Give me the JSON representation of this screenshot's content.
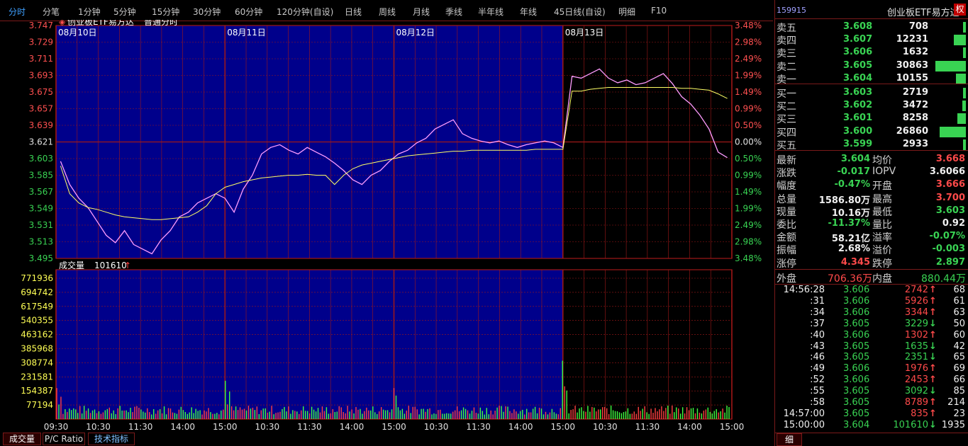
{
  "periods": [
    "分时",
    "分笔",
    "1分钟",
    "5分钟",
    "15分钟",
    "30分钟",
    "60分钟",
    "120分钟(自设)",
    "日线",
    "周线",
    "月线",
    "季线",
    "半年线",
    "年线",
    "45日线(自设)",
    "明细",
    "F10"
  ],
  "active_period": "分时",
  "chart": {
    "title": "创业板ETF易方达",
    "mode": "普通分时",
    "day_labels": [
      "08月10日",
      "08月11日",
      "08月12日",
      "08月13日"
    ],
    "price_ticks": [
      "3.747",
      "3.729",
      "3.711",
      "3.693",
      "3.675",
      "3.657",
      "3.639",
      "3.621",
      "3.603",
      "3.585",
      "3.567",
      "3.549",
      "3.531",
      "3.513",
      "3.495"
    ],
    "pct_ticks": [
      "3.48%",
      "2.98%",
      "2.49%",
      "1.99%",
      "1.49%",
      "0.99%",
      "0.50%",
      "0.00%",
      "0.50%",
      "0.99%",
      "1.49%",
      "1.99%",
      "2.49%",
      "2.98%",
      "3.48%"
    ],
    "volume_label": "成交量",
    "volume_value": "101610",
    "volume_ticks": [
      "771936",
      "694742",
      "617549",
      "540355",
      "463162",
      "385968",
      "308774",
      "231581",
      "154387",
      "77194"
    ],
    "time_ticks": [
      "09:30",
      "10:30",
      "11:30",
      "14:00",
      "15:00",
      "10:30",
      "11:30",
      "14:00",
      "15:00",
      "10:30",
      "11:30",
      "14:00",
      "15:00",
      "10:30",
      "11:30",
      "14:00",
      "15:00"
    ],
    "colors": {
      "bg_active": "#00008b",
      "grid": "#a01818",
      "price_line": "#ff9cff",
      "avg_line": "#ffff66",
      "up": "#ff4040",
      "down": "#40ff40"
    }
  },
  "chart_data": {
    "type": "line",
    "title": "创业板ETF易方达",
    "ylim": [
      3.495,
      3.747
    ],
    "prev_close": 3.621,
    "days": [
      "08月10日",
      "08月11日",
      "08月12日",
      "08月13日"
    ],
    "series": [
      {
        "name": "price",
        "values": [
          3.6,
          3.575,
          3.56,
          3.55,
          3.535,
          3.52,
          3.512,
          3.525,
          3.51,
          3.505,
          3.5,
          3.515,
          3.525,
          3.54,
          3.545,
          3.555,
          3.56,
          3.565,
          3.56,
          3.545,
          3.57,
          3.585,
          3.608,
          3.615,
          3.618,
          3.612,
          3.608,
          3.615,
          3.61,
          3.605,
          3.598,
          3.59,
          3.58,
          3.575,
          3.585,
          3.59,
          3.6,
          3.608,
          3.612,
          3.62,
          3.625,
          3.635,
          3.64,
          3.645,
          3.63,
          3.625,
          3.622,
          3.62,
          3.622,
          3.618,
          3.615,
          3.618,
          3.62,
          3.622,
          3.62,
          3.615,
          3.692,
          3.69,
          3.695,
          3.7,
          3.69,
          3.685,
          3.688,
          3.683,
          3.685,
          3.69,
          3.695,
          3.684,
          3.67,
          3.662,
          3.65,
          3.635,
          3.61,
          3.604
        ]
      },
      {
        "name": "avg",
        "values": [
          3.595,
          3.565,
          3.555,
          3.55,
          3.548,
          3.545,
          3.542,
          3.54,
          3.539,
          3.538,
          3.537,
          3.537,
          3.538,
          3.539,
          3.54,
          3.545,
          3.552,
          3.565,
          3.572,
          3.575,
          3.578,
          3.58,
          3.582,
          3.583,
          3.584,
          3.585,
          3.585,
          3.586,
          3.585,
          3.585,
          3.575,
          3.585,
          3.592,
          3.596,
          3.598,
          3.6,
          3.602,
          3.604,
          3.606,
          3.607,
          3.608,
          3.609,
          3.61,
          3.611,
          3.611,
          3.612,
          3.612,
          3.612,
          3.612,
          3.612,
          3.612,
          3.612,
          3.613,
          3.613,
          3.613,
          3.613,
          3.676,
          3.676,
          3.678,
          3.679,
          3.68,
          3.68,
          3.68,
          3.68,
          3.68,
          3.68,
          3.68,
          3.68,
          3.679,
          3.679,
          3.678,
          3.677,
          3.673,
          3.668
        ]
      }
    ],
    "volume_ylim": [
      0,
      771936
    ]
  },
  "quote": {
    "code": "159915",
    "name": "创业板ETF易方达",
    "badge": "权",
    "sell": [
      {
        "label": "卖五",
        "price": "3.608",
        "vol": "708",
        "bar": 0.05
      },
      {
        "label": "卖四",
        "price": "3.607",
        "vol": "12231",
        "bar": 0.35
      },
      {
        "label": "卖三",
        "price": "3.606",
        "vol": "1632",
        "bar": 0.05
      },
      {
        "label": "卖二",
        "price": "3.605",
        "vol": "30863",
        "bar": 0.9
      },
      {
        "label": "卖一",
        "price": "3.604",
        "vol": "10155",
        "bar": 0.3
      }
    ],
    "buy": [
      {
        "label": "买一",
        "price": "3.603",
        "vol": "2719",
        "bar": 0.08
      },
      {
        "label": "买二",
        "price": "3.602",
        "vol": "3472",
        "bar": 0.1
      },
      {
        "label": "买三",
        "price": "3.601",
        "vol": "8258",
        "bar": 0.24
      },
      {
        "label": "买四",
        "price": "3.600",
        "vol": "26860",
        "bar": 0.78
      },
      {
        "label": "买五",
        "price": "3.599",
        "vol": "2933",
        "bar": 0.09
      }
    ],
    "stats": [
      {
        "l1": "最新",
        "v1": "3.604",
        "c1": "green",
        "l2": "均价",
        "v2": "3.668",
        "c2": "red"
      },
      {
        "l1": "涨跌",
        "v1": "-0.017",
        "c1": "green",
        "l2": "IOPV",
        "v2": "3.6066",
        "c2": "white"
      },
      {
        "l1": "幅度",
        "v1": "-0.47%",
        "c1": "green",
        "l2": "开盘",
        "v2": "3.666",
        "c2": "red"
      },
      {
        "l1": "总量",
        "v1": "1586.80万",
        "c1": "white",
        "l2": "最高",
        "v2": "3.700",
        "c2": "red"
      },
      {
        "l1": "现量",
        "v1": "10.16万",
        "c1": "white",
        "l2": "最低",
        "v2": "3.603",
        "c2": "green"
      },
      {
        "l1": "委比",
        "v1": "-11.37%",
        "c1": "green",
        "l2": "量比",
        "v2": "0.92",
        "c2": "white"
      },
      {
        "l1": "金额",
        "v1": "58.21亿",
        "c1": "white",
        "l2": "溢率",
        "v2": "-0.07%",
        "c2": "green"
      },
      {
        "l1": "振幅",
        "v1": "2.68%",
        "c1": "white",
        "l2": "溢价",
        "v2": "-0.003",
        "c2": "green"
      },
      {
        "l1": "涨停",
        "v1": "4.345",
        "c1": "red",
        "l2": "跌停",
        "v2": "2.897",
        "c2": "green"
      }
    ],
    "outer_label": "外盘",
    "outer_value": "706.36万",
    "inner_label": "内盘",
    "inner_value": "880.44万",
    "ticks": [
      {
        "time": "14:56:28",
        "price": "3.606",
        "vol": "2742",
        "dir": "↑",
        "n": "68"
      },
      {
        "time": ":31",
        "price": "3.606",
        "vol": "5926",
        "dir": "↑",
        "n": "61"
      },
      {
        "time": ":34",
        "price": "3.606",
        "vol": "3344",
        "dir": "↑",
        "n": "63"
      },
      {
        "time": ":37",
        "price": "3.605",
        "vol": "3229",
        "dir": "↓",
        "n": "50"
      },
      {
        "time": ":40",
        "price": "3.606",
        "vol": "1302",
        "dir": "↑",
        "n": "60"
      },
      {
        "time": ":43",
        "price": "3.605",
        "vol": "1635",
        "dir": "↓",
        "n": "42"
      },
      {
        "time": ":46",
        "price": "3.605",
        "vol": "2351",
        "dir": "↓",
        "n": "65"
      },
      {
        "time": ":49",
        "price": "3.606",
        "vol": "1976",
        "dir": "↑",
        "n": "69"
      },
      {
        "time": ":52",
        "price": "3.606",
        "vol": "2453",
        "dir": "↑",
        "n": "66"
      },
      {
        "time": ":55",
        "price": "3.605",
        "vol": "3092",
        "dir": "↓",
        "n": "85"
      },
      {
        "time": ":58",
        "price": "3.605",
        "vol": "8789",
        "dir": "↑",
        "n": "214"
      },
      {
        "time": "14:57:00",
        "price": "3.605",
        "vol": "835",
        "dir": "↑",
        "n": "23"
      },
      {
        "time": "15:00:00",
        "price": "3.604",
        "vol": "101610",
        "dir": "↓",
        "n": "1935"
      }
    ],
    "detail_tab": "细"
  },
  "bottom_tabs": [
    "成交量",
    "P/C Ratio",
    "技术指标"
  ]
}
